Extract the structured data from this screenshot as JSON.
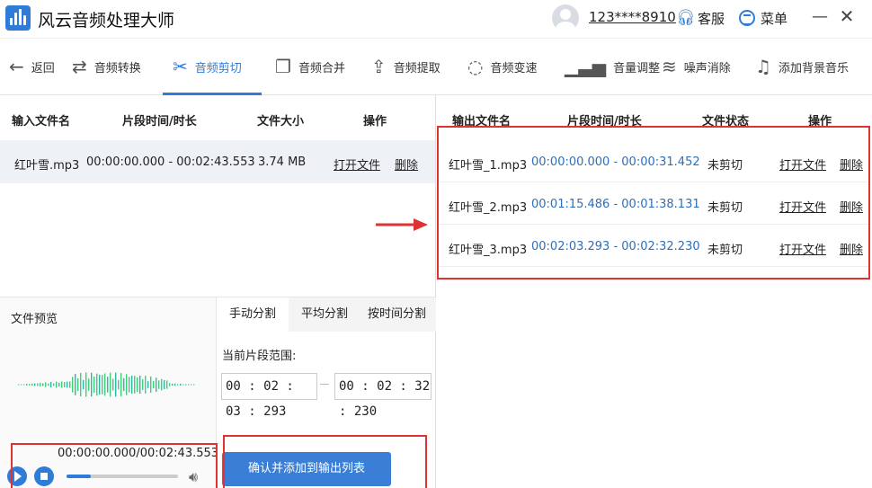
{
  "app": {
    "title": "风云音频处理大师",
    "username": "123****8910",
    "customer_service": "客服",
    "menu": "菜单"
  },
  "toolbar": [
    {
      "label": "返回",
      "icon": "back-arrow-icon"
    },
    {
      "label": "音频转换",
      "icon": "convert-icon"
    },
    {
      "label": "音频剪切",
      "icon": "scissors-icon",
      "active": true
    },
    {
      "label": "音频合并",
      "icon": "merge-icon"
    },
    {
      "label": "音频提取",
      "icon": "extract-icon"
    },
    {
      "label": "音频变速",
      "icon": "speed-icon"
    },
    {
      "label": "音量调整",
      "icon": "volume-bars-icon"
    },
    {
      "label": "噪声消除",
      "icon": "noise-icon"
    },
    {
      "label": "添加背景音乐",
      "icon": "music-note-icon"
    }
  ],
  "input_table": {
    "headers": [
      "输入文件名",
      "片段时间/时长",
      "文件大小",
      "操作"
    ],
    "row": {
      "name": "红叶雪.mp3",
      "time": "00:00:00.000 - 00:02:43.553",
      "size": "3.74 MB",
      "open": "打开文件",
      "delete": "删除"
    }
  },
  "preview": {
    "label": "文件预览",
    "time": "00:00:00.000/00:02:43.553",
    "progress": 0.22
  },
  "split": {
    "tabs": [
      "手动分割",
      "平均分割",
      "按时间分割"
    ],
    "active_tab": 0,
    "range_label": "当前片段范围:",
    "start": "00 : 02 : 03 : 293",
    "end": "00 : 02 : 32 : 230",
    "confirm": "确认并添加到输出列表"
  },
  "output_table": {
    "headers": [
      "输出文件名",
      "片段时间/时长",
      "文件状态",
      "操作"
    ],
    "rows": [
      {
        "name": "红叶雪_1.mp3",
        "time": "00:00:00.000 - 00:00:31.452",
        "status": "未剪切",
        "open": "打开文件",
        "delete": "删除"
      },
      {
        "name": "红叶雪_2.mp3",
        "time": "00:01:15.486 - 00:01:38.131",
        "status": "未剪切",
        "open": "打开文件",
        "delete": "删除"
      },
      {
        "name": "红叶雪_3.mp3",
        "time": "00:02:03.293 - 00:02:32.230",
        "status": "未剪切",
        "open": "打开文件",
        "delete": "删除"
      }
    ]
  },
  "colors": {
    "accent": "#2f7cd8",
    "highlight": "#d33333",
    "link_time": "#2d6fba"
  }
}
